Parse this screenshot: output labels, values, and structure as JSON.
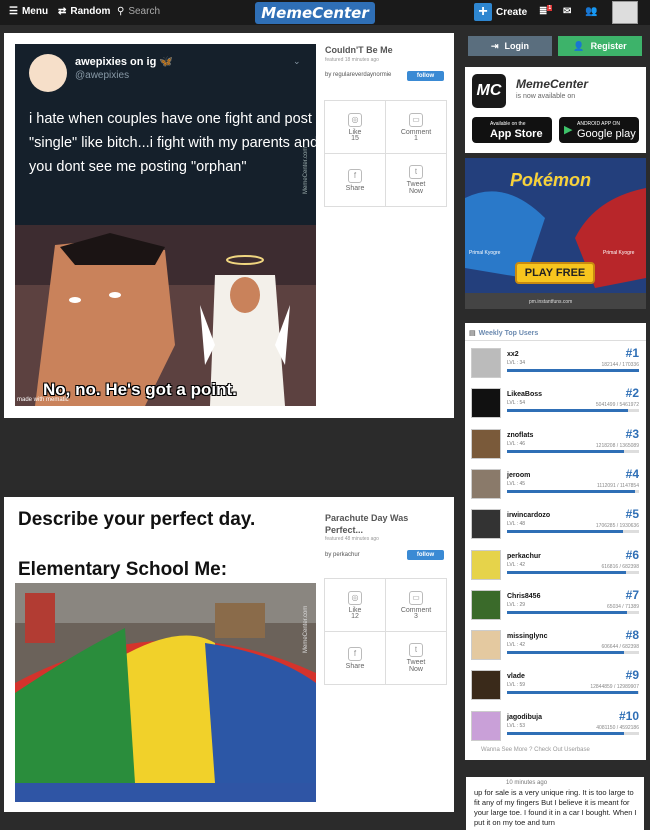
{
  "topbar": {
    "menu": "Menu",
    "random": "Random",
    "search": "Search",
    "logo": "MemeCenter",
    "create": "Create",
    "notif_count": "1"
  },
  "post1": {
    "title": "Couldn'T Be Me",
    "featured": "featured 18 minutes ago",
    "by": "by regulareverdaynormie",
    "follow": "follow",
    "tweet_name": "awepixies on ig 🦋",
    "tweet_handle": "@awepixies",
    "tweet_text": "i hate when couples have one fight and post \"single\" like bitch...i fight with my parents and you dont see me posting \"orphan\"",
    "caption": "No, no. He's got a point.",
    "made_with": "made with mematic",
    "watermark": "MemeCenter.com",
    "like_label": "Like",
    "like_count": "15",
    "comment_label": "Comment",
    "comment_count": "1",
    "share": "Share",
    "tweet": "Tweet Now"
  },
  "post2": {
    "title": "Parachute Day Was Perfect...",
    "featured": "featured 48 minutes ago",
    "by": "by perkachur",
    "follow": "follow",
    "line1": "Describe your perfect day.",
    "line2": "Elementary School Me:",
    "watermark": "MemeCenter.com",
    "like_label": "Like",
    "like_count": "12",
    "comment_label": "Comment",
    "comment_count": "3",
    "share": "Share",
    "tweet": "Tweet Now"
  },
  "auth": {
    "login": "Login",
    "register": "Register"
  },
  "app": {
    "name": "MemeCenter",
    "tagline": "is now available on",
    "appstore_top": "Available on the",
    "appstore": "App Store",
    "google_top": "ANDROID APP ON",
    "google": "Google play"
  },
  "ad": {
    "game": "Pokémon",
    "play": "PLAY FREE",
    "url": "pm.instantfuns.com",
    "left_tag": "Primal Kyogre",
    "right_tag": "Primal Kyogre"
  },
  "top_users": {
    "title": "Weekly Top Users",
    "footer": "Wanna See More ? Check Out Userbase",
    "users": [
      {
        "name": "xx2",
        "lvl": "LVL : 34",
        "rank": "#1",
        "pts": "182144 / 170336",
        "fill": 1.0
      },
      {
        "name": "LikeaBoss",
        "lvl": "LVL : 54",
        "rank": "#2",
        "pts": "5041499 / 5461972",
        "fill": 0.92
      },
      {
        "name": "znoflats",
        "lvl": "LVL : 46",
        "rank": "#3",
        "pts": "1218208 / 1365089",
        "fill": 0.89
      },
      {
        "name": "jeroom",
        "lvl": "LVL : 45",
        "rank": "#4",
        "pts": "1112091 / 1147854",
        "fill": 0.97
      },
      {
        "name": "irwincardozo",
        "lvl": "LVL : 48",
        "rank": "#5",
        "pts": "1706285 / 1930636",
        "fill": 0.88
      },
      {
        "name": "perkachur",
        "lvl": "LVL : 42",
        "rank": "#6",
        "pts": "616816 / 682398",
        "fill": 0.9
      },
      {
        "name": "Chris8456",
        "lvl": "LVL : 29",
        "rank": "#7",
        "pts": "65034 / 71389",
        "fill": 0.91
      },
      {
        "name": "missinglync",
        "lvl": "LVL : 42",
        "rank": "#8",
        "pts": "606644 / 682398",
        "fill": 0.89
      },
      {
        "name": "vlade",
        "lvl": "LVL : 59",
        "rank": "#9",
        "pts": "12844859 / 12989907",
        "fill": 0.99
      },
      {
        "name": "jagodibuja",
        "lvl": "LVL : 53",
        "rank": "#10",
        "pts": "4081150 / 4592186",
        "fill": 0.89
      }
    ]
  },
  "comment": {
    "time": "10 minutes ago",
    "text": "up for sale is a very unique ring. It is too large to fit any of my fingers But I believe it is meant for your large toe. I found it in a car I bought. When I put it on my toe and turn"
  }
}
